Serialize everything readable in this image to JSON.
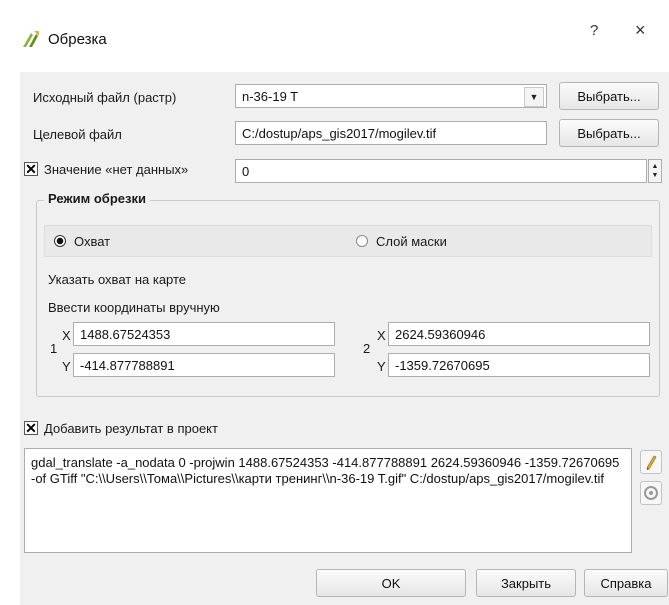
{
  "window": {
    "title": "Обрезка",
    "help_label": "?",
    "close_label": "×"
  },
  "source": {
    "label": "Исходный файл (растр)",
    "value": "n-36-19 T",
    "browse_label": "Выбрать..."
  },
  "target": {
    "label": "Целевой файл",
    "value": "C:/dostup/aps_gis2017/mogilev.tif",
    "browse_label": "Выбрать..."
  },
  "nodata": {
    "checked_mark": "✕",
    "label": "Значение «нет данных»",
    "value": "0"
  },
  "clip_mode": {
    "title": "Режим обрезки",
    "option_extent": "Охват",
    "option_mask": "Слой маски",
    "hint_map": "Указать охват на карте",
    "hint_manual": "Ввести координаты вручную",
    "p1": {
      "index": "1",
      "x_label": "X",
      "y_label": "Y",
      "x": "1488.67524353",
      "y": "-414.877788891"
    },
    "p2": {
      "index": "2",
      "x_label": "X",
      "y_label": "Y",
      "x": "2624.59360946",
      "y": "-1359.72670695"
    }
  },
  "add_result": {
    "checked_mark": "✕",
    "label": "Добавить результат в проект"
  },
  "command": {
    "text": "gdal_translate -a_nodata 0 -projwin 1488.67524353 -414.877788891 2624.59360946 -1359.72670695 -of GTiff \"C:\\\\Users\\\\Тома\\\\Pictures\\\\карти тренинг\\\\n-36-19 T.gif\" C:/dostup/aps_gis2017/mogilev.tif"
  },
  "buttons": {
    "ok": "OK",
    "close": "Закрыть",
    "help": "Справка"
  }
}
